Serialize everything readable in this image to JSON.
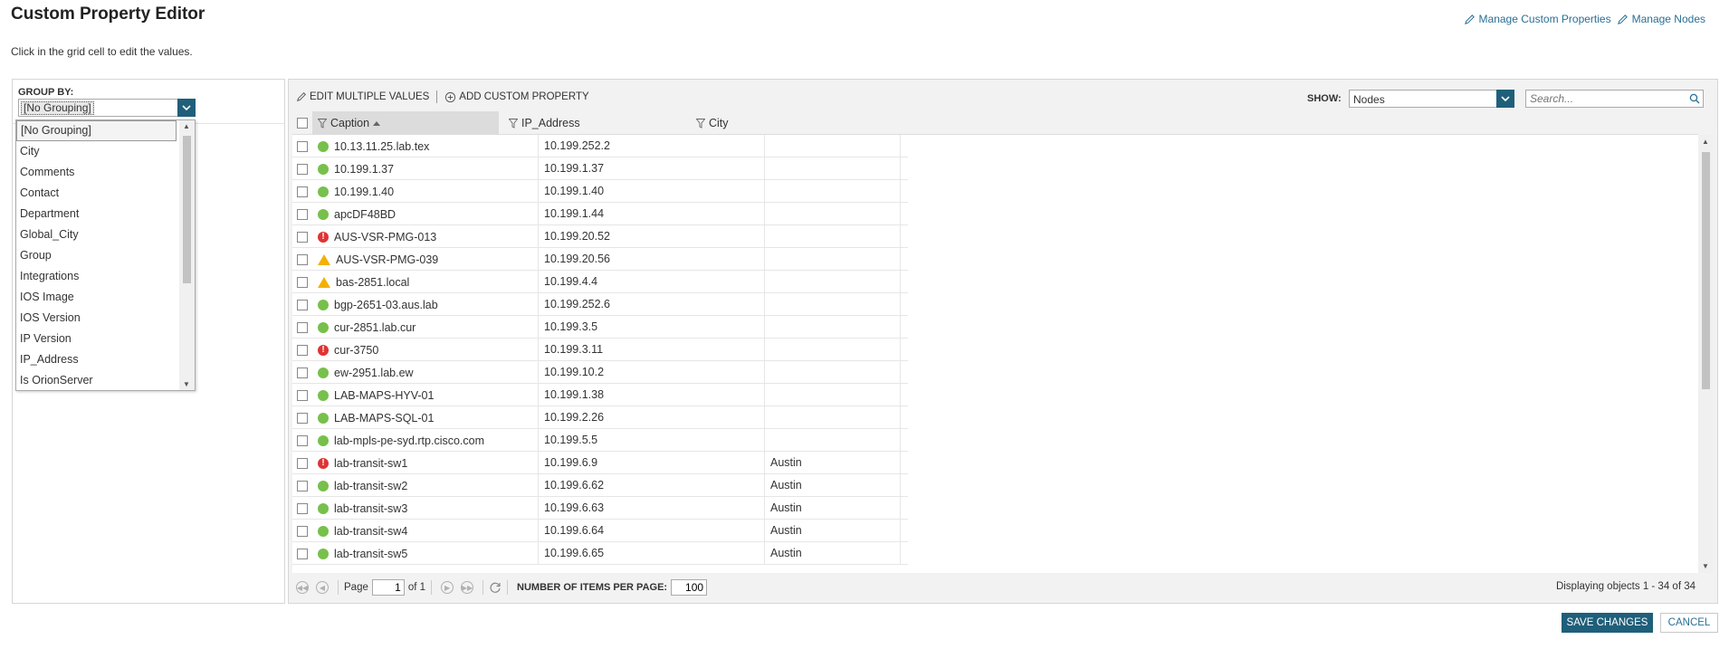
{
  "page": {
    "title": "Custom Property Editor",
    "subtitle": "Click in the grid cell to edit the values."
  },
  "top_links": {
    "manage_custom_properties": "Manage Custom Properties",
    "manage_nodes": "Manage Nodes"
  },
  "group_by": {
    "label": "GROUP BY:",
    "selected": "[No Grouping]",
    "options": [
      "[No Grouping]",
      "City",
      "Comments",
      "Contact",
      "Department",
      "Global_City",
      "Group",
      "Integrations",
      "IOS Image",
      "IOS Version",
      "IP Version",
      "IP_Address",
      "Is OrionServer"
    ]
  },
  "toolbar": {
    "edit_multiple_values": "EDIT MULTIPLE VALUES",
    "add_custom_property": "ADD CUSTOM PROPERTY",
    "show_label": "SHOW:",
    "show_value": "Nodes",
    "search_placeholder": "Search..."
  },
  "grid": {
    "columns": [
      "Caption",
      "IP_Address",
      "City"
    ],
    "rows": [
      {
        "caption": "10.13.11.25.lab.tex",
        "ip": "10.199.252.2",
        "city": "",
        "status": "up"
      },
      {
        "caption": "10.199.1.37",
        "ip": "10.199.1.37",
        "city": "",
        "status": "up"
      },
      {
        "caption": "10.199.1.40",
        "ip": "10.199.1.40",
        "city": "",
        "status": "up"
      },
      {
        "caption": "apcDF48BD",
        "ip": "10.199.1.44",
        "city": "",
        "status": "up"
      },
      {
        "caption": "AUS-VSR-PMG-013",
        "ip": "10.199.20.52",
        "city": "",
        "status": "down"
      },
      {
        "caption": "AUS-VSR-PMG-039",
        "ip": "10.199.20.56",
        "city": "",
        "status": "warn"
      },
      {
        "caption": "bas-2851.local",
        "ip": "10.199.4.4",
        "city": "",
        "status": "warn"
      },
      {
        "caption": "bgp-2651-03.aus.lab",
        "ip": "10.199.252.6",
        "city": "",
        "status": "up"
      },
      {
        "caption": "cur-2851.lab.cur",
        "ip": "10.199.3.5",
        "city": "",
        "status": "up"
      },
      {
        "caption": "cur-3750",
        "ip": "10.199.3.11",
        "city": "",
        "status": "down"
      },
      {
        "caption": "ew-2951.lab.ew",
        "ip": "10.199.10.2",
        "city": "",
        "status": "up"
      },
      {
        "caption": "LAB-MAPS-HYV-01",
        "ip": "10.199.1.38",
        "city": "",
        "status": "up"
      },
      {
        "caption": "LAB-MAPS-SQL-01",
        "ip": "10.199.2.26",
        "city": "",
        "status": "up"
      },
      {
        "caption": "lab-mpls-pe-syd.rtp.cisco.com",
        "ip": "10.199.5.5",
        "city": "",
        "status": "up"
      },
      {
        "caption": "lab-transit-sw1",
        "ip": "10.199.6.9",
        "city": "Austin",
        "status": "down"
      },
      {
        "caption": "lab-transit-sw2",
        "ip": "10.199.6.62",
        "city": "Austin",
        "status": "up"
      },
      {
        "caption": "lab-transit-sw3",
        "ip": "10.199.6.63",
        "city": "Austin",
        "status": "up"
      },
      {
        "caption": "lab-transit-sw4",
        "ip": "10.199.6.64",
        "city": "Austin",
        "status": "up"
      },
      {
        "caption": "lab-transit-sw5",
        "ip": "10.199.6.65",
        "city": "Austin",
        "status": "up"
      }
    ]
  },
  "pager": {
    "page_label": "Page",
    "page_value": "1",
    "of_label": "of 1",
    "per_page_label": "NUMBER OF ITEMS PER PAGE:",
    "per_page_value": "100",
    "displaying": "Displaying objects 1 - 34 of 34"
  },
  "actions": {
    "save": "SAVE CHANGES",
    "cancel": "CANCEL"
  },
  "colors": {
    "accent": "#1f5f7a",
    "link": "#2a6f94",
    "status_up": "#77c04b",
    "status_down": "#e03333",
    "status_warn": "#f2b100"
  }
}
